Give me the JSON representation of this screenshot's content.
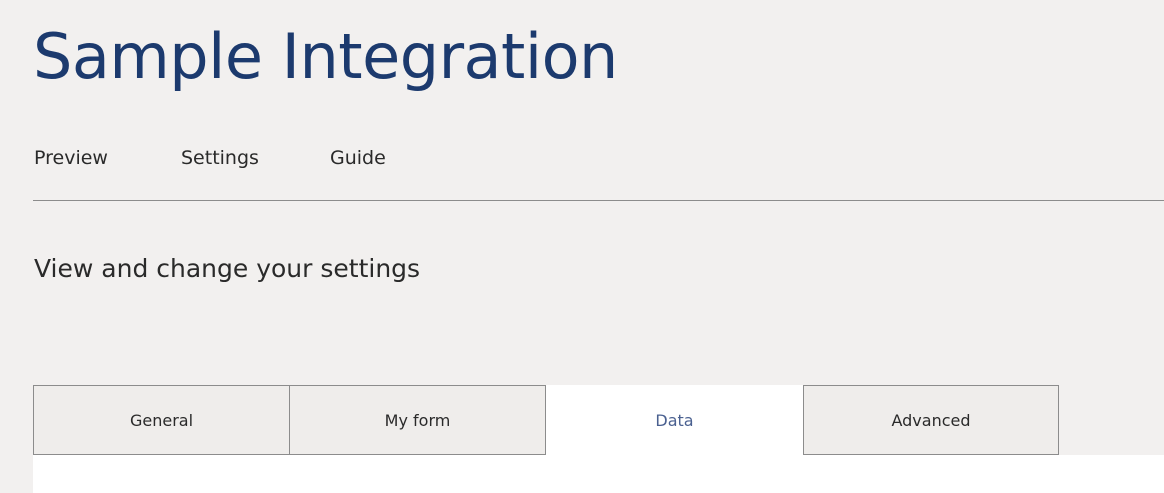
{
  "header": {
    "title": "Sample Integration"
  },
  "nav": {
    "items": [
      {
        "label": "Preview"
      },
      {
        "label": "Settings"
      },
      {
        "label": "Guide"
      }
    ]
  },
  "main": {
    "subtitle": "View and change your settings",
    "tabs": [
      {
        "label": "General",
        "active": false
      },
      {
        "label": "My form",
        "active": false
      },
      {
        "label": "Data",
        "active": true
      },
      {
        "label": "Advanced",
        "active": false
      }
    ]
  },
  "colors": {
    "title": "#1c3a6e",
    "active_tab_text": "#4a6090",
    "background": "#f2f0ef"
  }
}
